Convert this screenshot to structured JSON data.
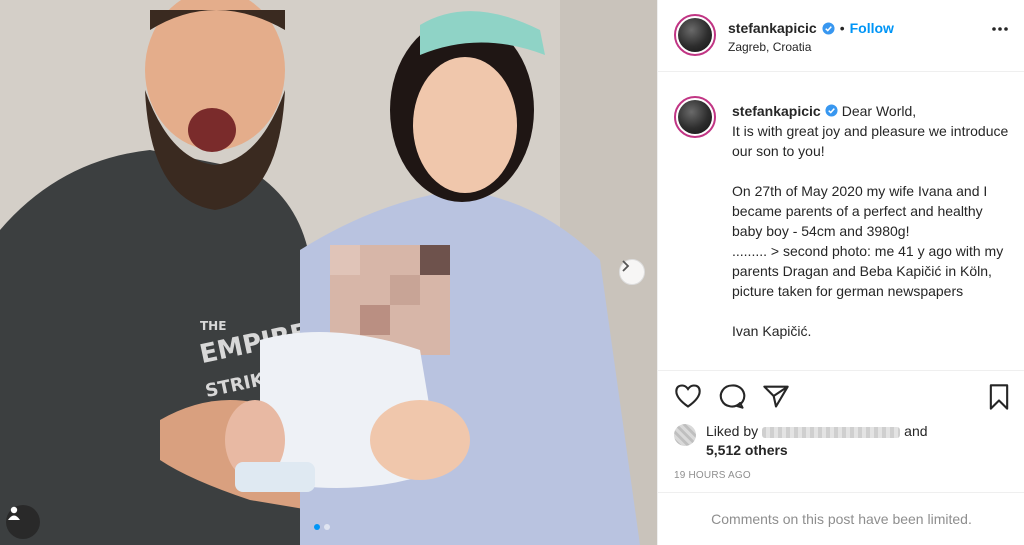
{
  "post": {
    "username": "stefankapicic",
    "separator": "•",
    "follow_label": "Follow",
    "location": "Zagreb, Croatia",
    "caption": "Dear World,\nIt is with great joy and pleasure we introduce our son to you!\n\nOn 27th of May 2020 my wife Ivana and I became parents of a perfect and healthy baby boy - 54cm and 3980g!\n......... > second photo: me 41 y ago with my parents Dragan and Beba Kapičić in Köln, picture taken for german newspapers\n\nIvan Kapičić.",
    "likes_prefix": "Liked by",
    "likes_and": "and",
    "likes_count": "5,512 others",
    "timestamp": "19 HOURS AGO",
    "comments_notice": "Comments on this post have been limited.",
    "photo_shirt_text": [
      "THE",
      "EMPIRE",
      "STRIKES BACK"
    ]
  },
  "carousel": {
    "current": 1,
    "total": 2
  },
  "icons": [
    "verified-badge-icon",
    "more-options-icon",
    "heart-icon",
    "comment-icon",
    "share-icon",
    "bookmark-icon",
    "chevron-right-icon",
    "user-tag-icon"
  ],
  "colors": {
    "accent": "#0095f6",
    "text": "#262626",
    "muted": "#8e8e8e",
    "border": "#efefef"
  }
}
